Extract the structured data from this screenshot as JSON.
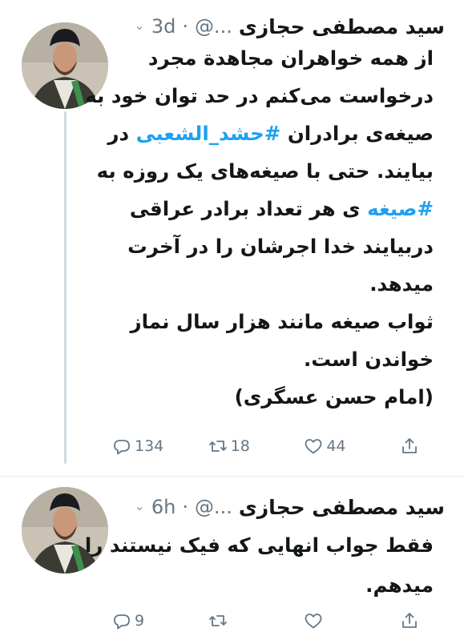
{
  "tweets": [
    {
      "author_name": "سید مصطفی حجازی",
      "handle": "@...",
      "time": "3d",
      "lines": [
        [
          "از همه خواهران مجاهدة مجرد"
        ],
        [
          "درخواست می‌کنم در حد توان خود به"
        ],
        [
          "صیغه‌ی برادران ",
          {
            "tag": "#حشد_الشعبی"
          },
          " در"
        ],
        [
          "بیایند. حتی با صیغه‌های یک روزه به"
        ],
        [
          {
            "tag": "#صیغه"
          },
          " ی هر تعداد برادر عراقی"
        ],
        [
          "دربیایند خدا اجرشان را در آخرت"
        ],
        [
          "میدهد."
        ],
        [
          "ثواب صیغه مانند هزار سال نماز"
        ],
        [
          "خواندن است."
        ],
        [
          "(امام حسن عسگری)"
        ]
      ],
      "reply_count": "134",
      "retweet_count": "18",
      "like_count": "44"
    },
    {
      "author_name": "سید مصطفی حجازی",
      "handle": "@...",
      "time": "6h",
      "lines": [
        [
          "فقط جواب انهایی که فیک نیستند را"
        ],
        [
          "میدهم."
        ]
      ],
      "reply_count": "9",
      "retweet_count": "",
      "like_count": ""
    }
  ],
  "icons": {
    "reply": "reply-icon",
    "retweet": "retweet-icon",
    "like": "heart-icon",
    "share": "share-icon",
    "menu": "chevron-down-icon"
  },
  "colors": {
    "link": "#1da1f2",
    "meta": "#657786",
    "text": "#14171a",
    "thread_line": "#cfd9de"
  }
}
